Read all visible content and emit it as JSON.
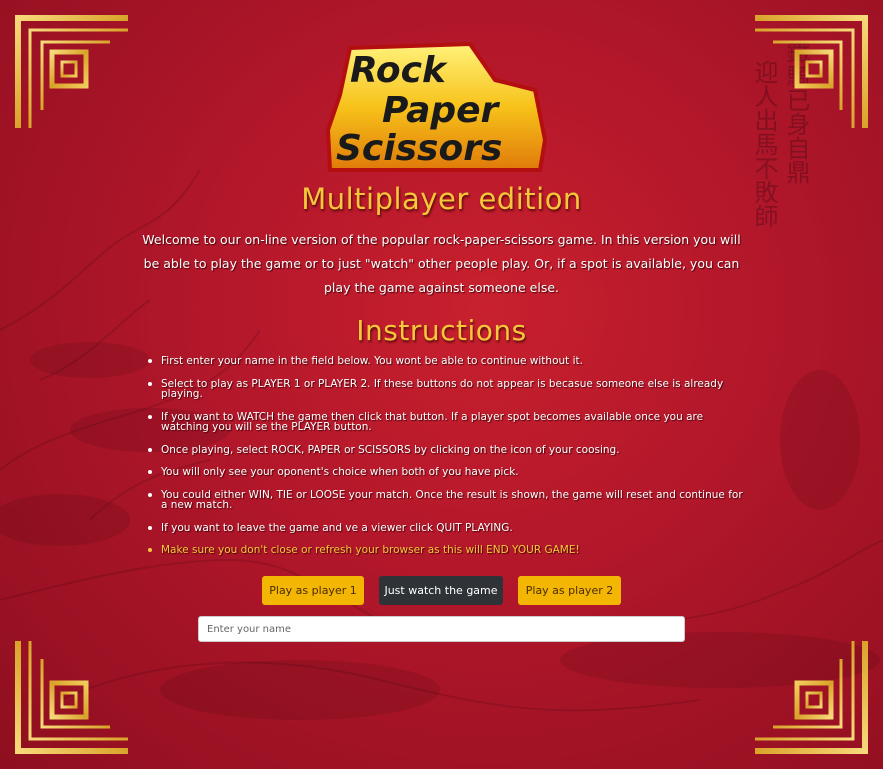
{
  "logo": {
    "line1": "Rock",
    "line2": "Paper",
    "line3": "Scissors"
  },
  "title": "Multiplayer edition",
  "intro": "Welcome to our on-line version of the popular rock-paper-scissors game. In this version you will be able to play the game or to just \"watch\" other people play. Or, if a spot is available, you can play the game against someone else.",
  "instructions_heading": "Instructions",
  "instructions": [
    "First enter your name in the field below. You wont be able to continue without it.",
    "Select to play as PLAYER 1 or PLAYER 2. If these buttons do not appear is becasue someone else is already playing.",
    "If you want to WATCH the game then click that button. If a player spot becomes available once you are watching you will se the PLAYER button.",
    "Once playing, select ROCK, PAPER or SCISSORS by clicking on the icon of your coosing.",
    "You will only see your oponent's choice when both of you have pick.",
    "You could either WIN, TIE or LOOSE your match. Once the result is shown, the game will reset and continue for a new match.",
    "If you want to leave the game and ve a viewer click QUIT PLAYING.",
    "Make sure you don't close or refresh your browser as this will END YOUR GAME!"
  ],
  "buttons": {
    "player1": "Play as player 1",
    "watch": "Just watch the game",
    "player2": "Play as player 2"
  },
  "name_input": {
    "placeholder": "Enter your name",
    "value": ""
  },
  "colors": {
    "background": "#b0162a",
    "gold": "#f6c73b",
    "button_yellow": "#f3b602",
    "button_dark": "#2f3338"
  }
}
